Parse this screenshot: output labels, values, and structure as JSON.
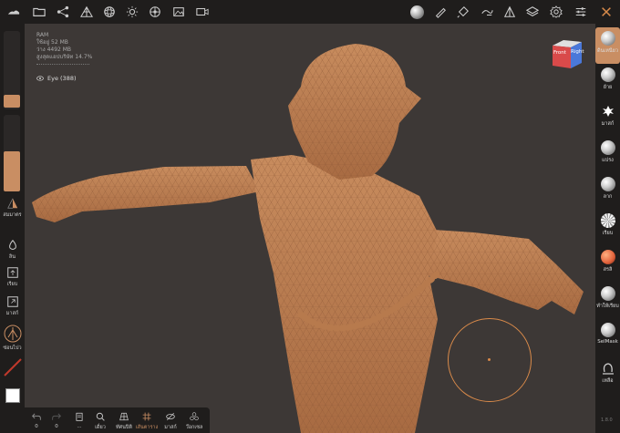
{
  "stats": {
    "ram_label": "RAM",
    "used": "ใช้อยู่ 52 MB",
    "free": "ว่าง 4492 MB",
    "cap": "สูงสุดแอปบริษัท 14.7%"
  },
  "layer_item": {
    "label": "Eye (388)"
  },
  "left_tools": {
    "symmetry": "สมมาตร",
    "dynamic": "ลิน",
    "smooth": "เรียบ",
    "mask": "มาสก์",
    "hide": "ซ่อนไปว"
  },
  "right_tools": [
    {
      "label": "ดินเหนียว"
    },
    {
      "label": "ย้าย"
    },
    {
      "label": "มาสก์"
    },
    {
      "label": "แปรง"
    },
    {
      "label": "ลาก"
    },
    {
      "label": "เรียบ"
    },
    {
      "label": "สรลิ"
    },
    {
      "label": "ทำให้เรียบ"
    },
    {
      "label": "SelMask"
    },
    {
      "label": "เหลือ"
    }
  ],
  "bottom_tools": {
    "undo_count": "0",
    "redo_count": "0",
    "t1": "...",
    "t2": "เดี่ยว",
    "t3": "ทัศนปิติ",
    "t4": "เส้นตาราง",
    "t5": "มาสก์",
    "t6": "ว๊อกเซล"
  },
  "cube": {
    "front": "Front",
    "right": "Right"
  },
  "version": "1.8.0",
  "colors": {
    "accent": "#c98e63",
    "brush": "#d98a4a",
    "model": "#b5764a",
    "bg": "#3d3836",
    "toolbar": "#1f1d1c"
  }
}
